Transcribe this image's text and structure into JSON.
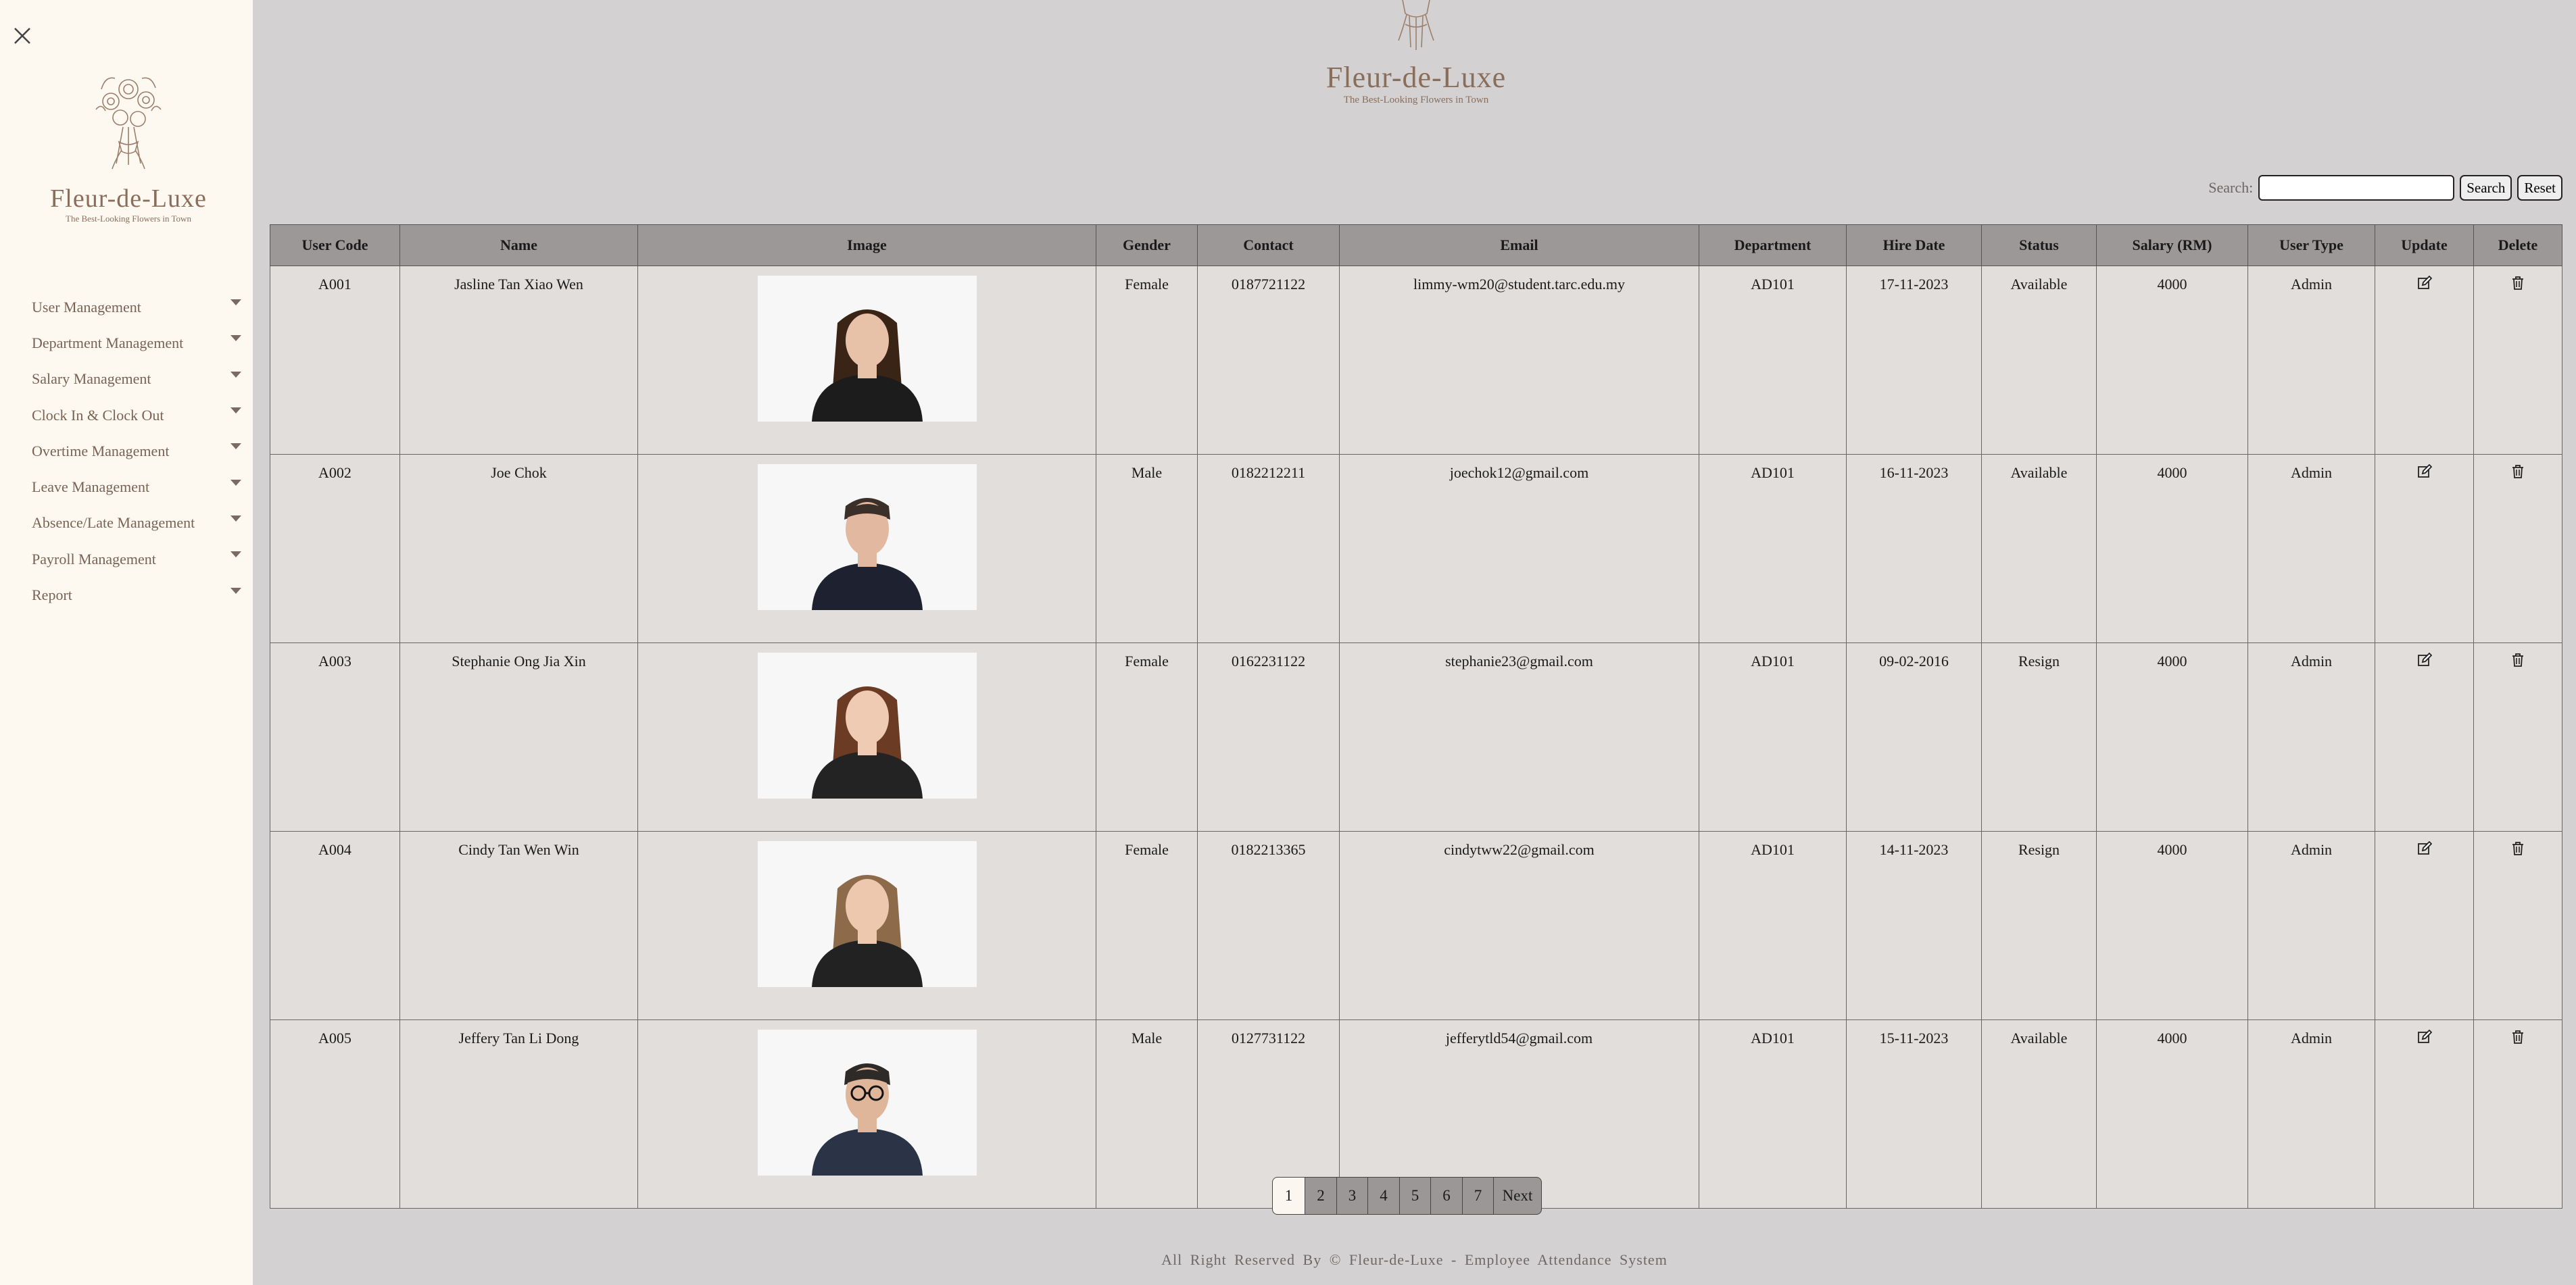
{
  "brand": {
    "name": "Fleur-de-Luxe",
    "tagline": "The Best-Looking Flowers in Town"
  },
  "sidebar": {
    "items": [
      {
        "label": "User Management"
      },
      {
        "label": "Department Management"
      },
      {
        "label": "Salary Management"
      },
      {
        "label": "Clock In & Clock Out"
      },
      {
        "label": "Overtime Management"
      },
      {
        "label": "Leave Management"
      },
      {
        "label": "Absence/Late Management"
      },
      {
        "label": "Payroll Management"
      },
      {
        "label": "Report"
      }
    ]
  },
  "search": {
    "label": "Search:",
    "value": "",
    "search_button": "Search",
    "reset_button": "Reset"
  },
  "table": {
    "headers": [
      "User Code",
      "Name",
      "Image",
      "Gender",
      "Contact",
      "Email",
      "Department",
      "Hire Date",
      "Status",
      "Salary (RM)",
      "User Type",
      "Update",
      "Delete"
    ],
    "rows": [
      {
        "code": "A001",
        "name": "Jasline Tan Xiao Wen",
        "gender": "Female",
        "contact": "0187721122",
        "email": "limmy-wm20@student.tarc.edu.my",
        "department": "AD101",
        "hire_date": "17-11-2023",
        "status": "Available",
        "salary": "4000",
        "user_type": "Admin"
      },
      {
        "code": "A002",
        "name": "Joe Chok",
        "gender": "Male",
        "contact": "0182212211",
        "email": "joechok12@gmail.com",
        "department": "AD101",
        "hire_date": "16-11-2023",
        "status": "Available",
        "salary": "4000",
        "user_type": "Admin"
      },
      {
        "code": "A003",
        "name": "Stephanie Ong Jia Xin",
        "gender": "Female",
        "contact": "0162231122",
        "email": "stephanie23@gmail.com",
        "department": "AD101",
        "hire_date": "09-02-2016",
        "status": "Resign",
        "salary": "4000",
        "user_type": "Admin"
      },
      {
        "code": "A004",
        "name": "Cindy Tan Wen Win",
        "gender": "Female",
        "contact": "0182213365",
        "email": "cindytww22@gmail.com",
        "department": "AD101",
        "hire_date": "14-11-2023",
        "status": "Resign",
        "salary": "4000",
        "user_type": "Admin"
      },
      {
        "code": "A005",
        "name": "Jeffery Tan Li Dong",
        "gender": "Male",
        "contact": "0127731122",
        "email": "jefferytld54@gmail.com",
        "department": "AD101",
        "hire_date": "15-11-2023",
        "status": "Available",
        "salary": "4000",
        "user_type": "Admin"
      }
    ]
  },
  "pagination": {
    "pages": [
      "1",
      "2",
      "3",
      "4",
      "5",
      "6",
      "7"
    ],
    "current": "1",
    "next_label": "Next"
  },
  "footer": {
    "text": "All Right Reserved By © Fleur-de-Luxe - Employee Attendance System"
  },
  "colors": {
    "status_resign": "#e0111b",
    "brand": "#8a6e5c",
    "sidebar_bg": "#fdf8f0",
    "page_bg": "#d3d1d1"
  },
  "icons": {
    "close": "close-icon",
    "update": "edit-icon",
    "delete": "trash-icon",
    "menu_caret": "caret-down-icon"
  }
}
